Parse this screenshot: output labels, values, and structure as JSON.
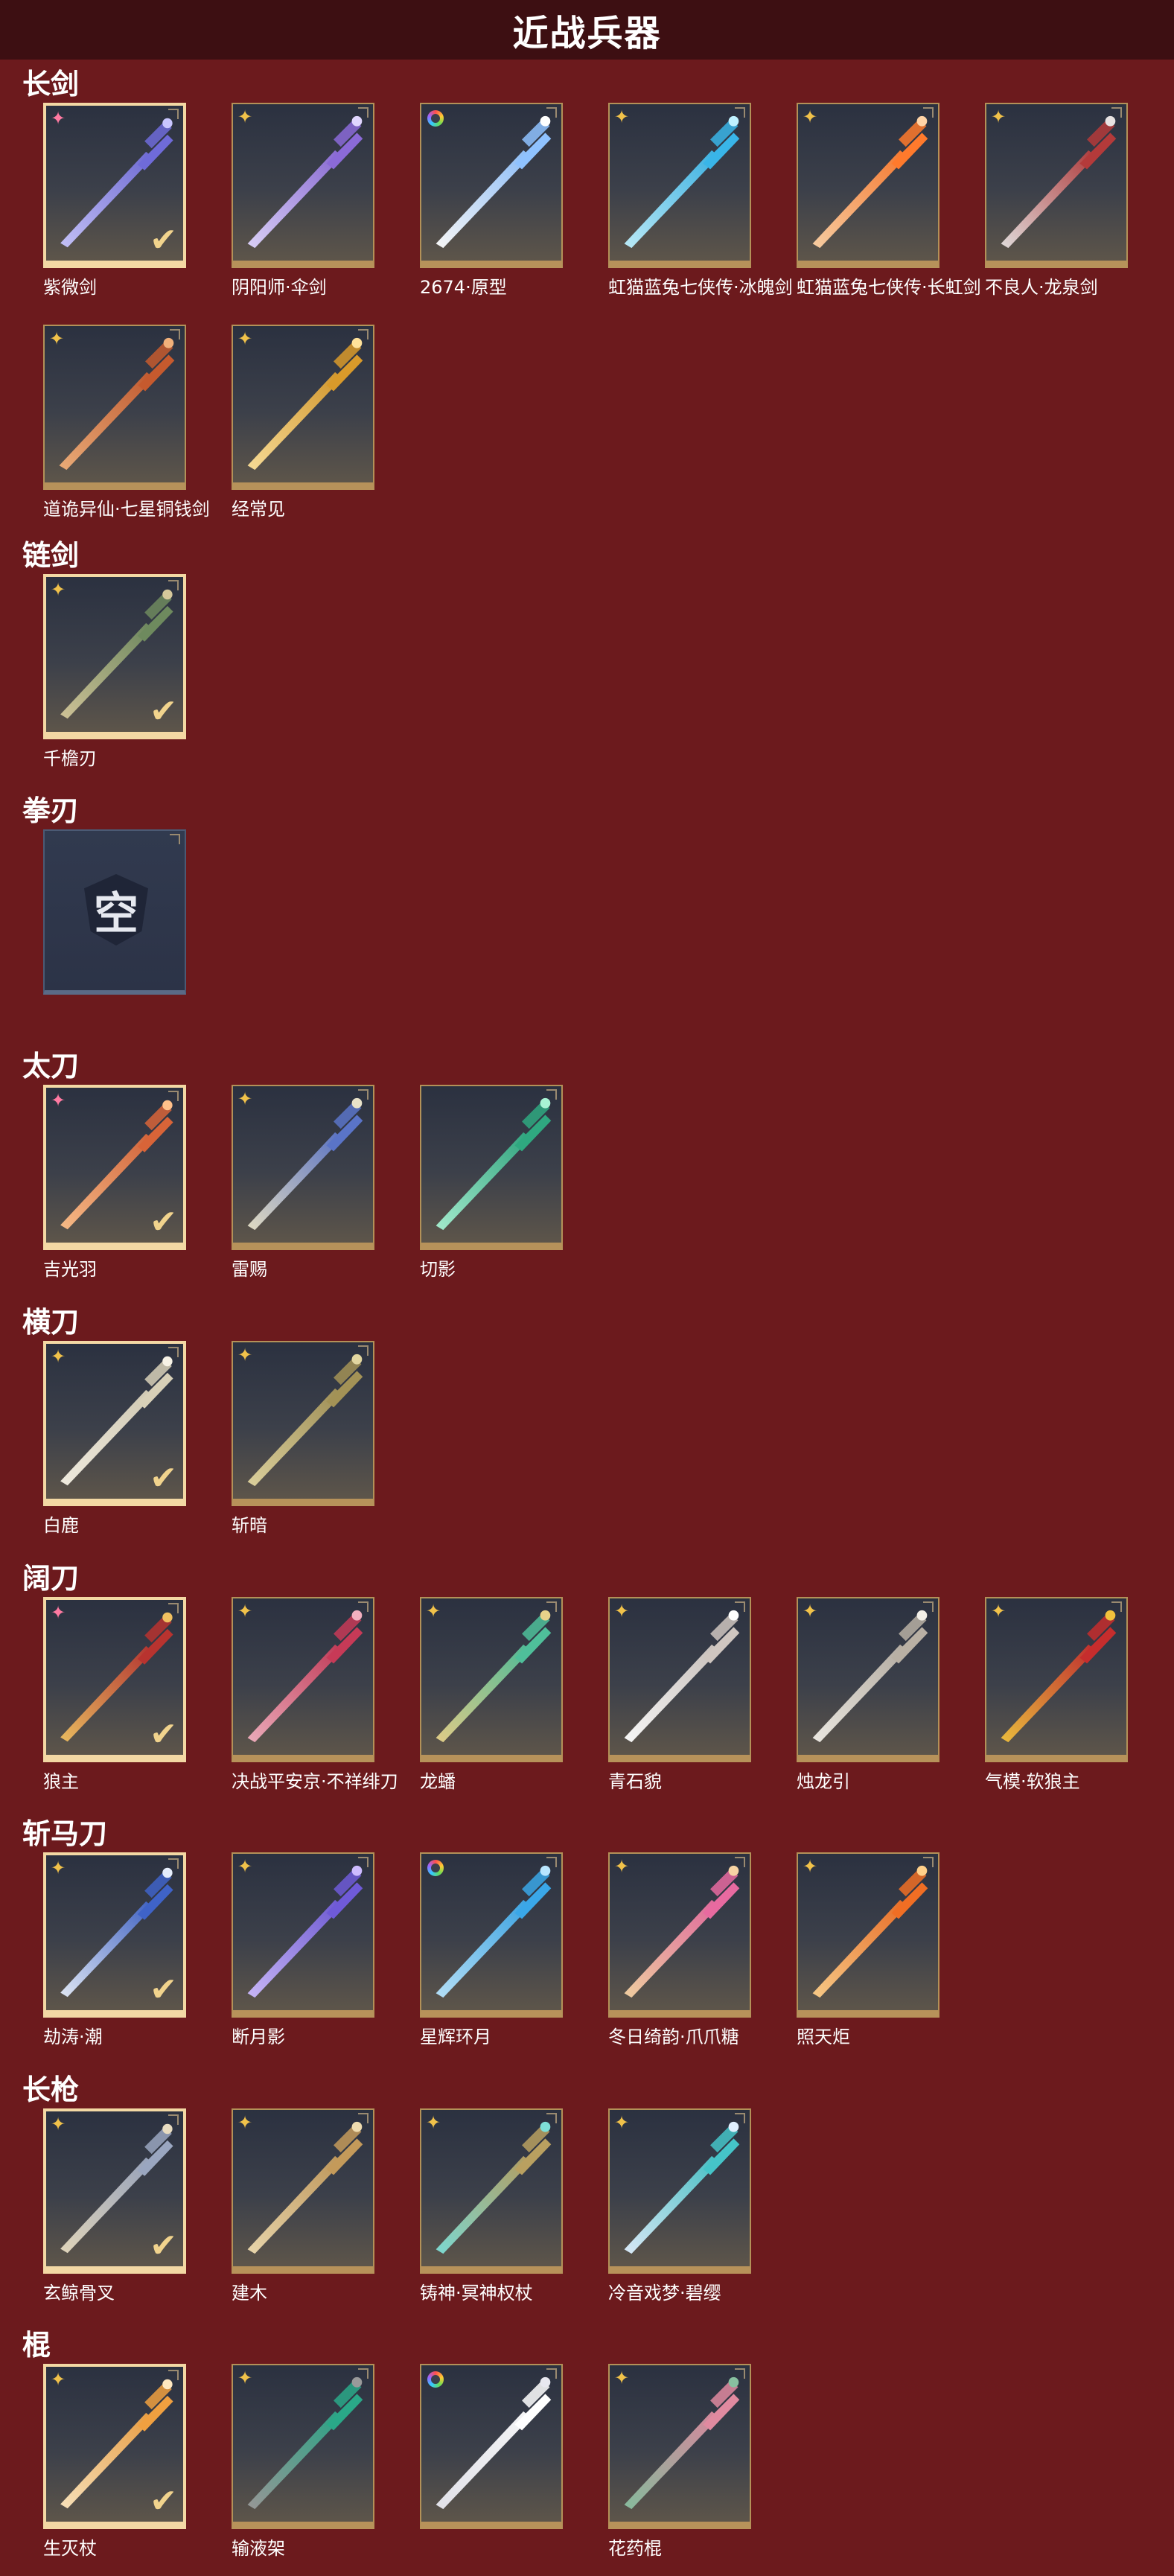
{
  "header": {
    "title": "近战兵器"
  },
  "categories": [
    {
      "label": "长剑",
      "items": [
        {
          "name": "紫微剑",
          "badge": "pink-star",
          "selected": true
        },
        {
          "name": "阴阳师·伞剑",
          "badge": "gold-star"
        },
        {
          "name": "2674·原型",
          "badge": "rainbow"
        },
        {
          "name": "虹猫蓝兔七侠传·冰魄剑",
          "badge": "gold-star"
        },
        {
          "name": "虹猫蓝兔七侠传·长虹剑",
          "badge": "gold-star"
        },
        {
          "name": "不良人·龙泉剑",
          "badge": "gold-star"
        },
        {
          "name": "道诡异仙·七星铜钱剑",
          "badge": "gold-star"
        },
        {
          "name": "经常见",
          "badge": "gold-star"
        }
      ]
    },
    {
      "label": "链剑",
      "items": [
        {
          "name": "千檐刃",
          "badge": "gold-star",
          "selected": true
        }
      ]
    },
    {
      "label": "拳刃",
      "items": [
        {
          "name": "",
          "empty": true,
          "empty_text": "空"
        }
      ]
    },
    {
      "label": "太刀",
      "items": [
        {
          "name": "吉光羽",
          "badge": "pink-star",
          "selected": true
        },
        {
          "name": "雷赐",
          "badge": "gold-star"
        },
        {
          "name": "切影",
          "badge": "none"
        }
      ]
    },
    {
      "label": "横刀",
      "items": [
        {
          "name": "白鹿",
          "badge": "gold-star",
          "selected": true
        },
        {
          "name": "斩暗",
          "badge": "gold-star"
        }
      ]
    },
    {
      "label": "阔刀",
      "items": [
        {
          "name": "狼主",
          "badge": "pink-star",
          "selected": true
        },
        {
          "name": "决战平安京·不祥绯刀",
          "badge": "gold-star"
        },
        {
          "name": "龙蟠",
          "badge": "gold-star"
        },
        {
          "name": "青石貌",
          "badge": "gold-star"
        },
        {
          "name": "烛龙引",
          "badge": "gold-star"
        },
        {
          "name": "气模·软狼主",
          "badge": "gold-star"
        }
      ]
    },
    {
      "label": "斩马刀",
      "items": [
        {
          "name": "劫涛·潮",
          "badge": "gold-star",
          "selected": true
        },
        {
          "name": "断月影",
          "badge": "gold-star"
        },
        {
          "name": "星辉环月",
          "badge": "rainbow"
        },
        {
          "name": "冬日绮韵·爪爪糖",
          "badge": "gold-star"
        },
        {
          "name": "照天炬",
          "badge": "gold-star"
        }
      ]
    },
    {
      "label": "长枪",
      "items": [
        {
          "name": "玄鲸骨叉",
          "badge": "gold-star",
          "selected": true
        },
        {
          "name": "建木",
          "badge": "gold-star"
        },
        {
          "name": "铸神·冥神权杖",
          "badge": "gold-star"
        },
        {
          "name": "冷音戏梦·碧缨",
          "badge": "gold-star"
        }
      ]
    },
    {
      "label": "棍",
      "items": [
        {
          "name": "生灭杖",
          "badge": "gold-star",
          "selected": true
        },
        {
          "name": "输液架",
          "badge": "gold-star"
        },
        {
          "name": "",
          "badge": "rainbow"
        },
        {
          "name": "花药棍",
          "badge": "gold-star"
        }
      ]
    }
  ],
  "colors": {
    "background": "#6c1a1d",
    "header": "#3d0f12",
    "card_border": "#b39158",
    "selected_border": "#f3d8a4",
    "check": "#f1d38d"
  }
}
